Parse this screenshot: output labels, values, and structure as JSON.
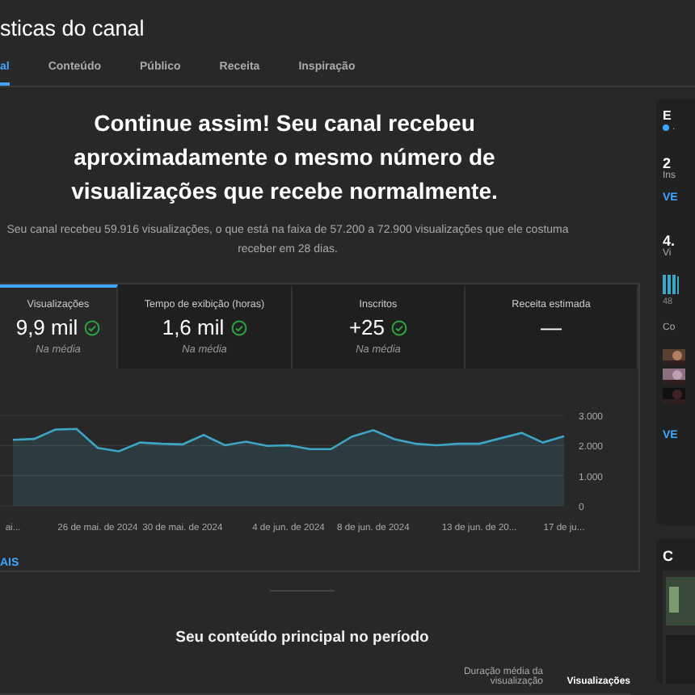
{
  "header": {
    "title": "sticas do canal"
  },
  "tabs": [
    {
      "label": "al",
      "selected": true
    },
    {
      "label": "Conteúdo",
      "selected": false
    },
    {
      "label": "Público",
      "selected": false
    },
    {
      "label": "Receita",
      "selected": false
    },
    {
      "label": "Inspiração",
      "selected": false
    }
  ],
  "summary": {
    "headline": "Continue assim! Seu canal recebeu aproximadamente o mesmo número de visualizações que recebe normalmente.",
    "detail": "Seu canal recebeu 59.916 visualizações, o que está na faixa de 57.200 a 72.900 visualizações que ele costuma receber em 28 dias."
  },
  "metrics": [
    {
      "label": "Visualizações",
      "value": "9,9 mil",
      "note": "Na média",
      "ok": true,
      "selected": true
    },
    {
      "label": "Tempo de exibição (horas)",
      "value": "1,6 mil",
      "note": "Na média",
      "ok": true,
      "selected": false
    },
    {
      "label": "Inscritos",
      "value": "+25",
      "note": "Na média",
      "ok": true,
      "selected": false
    },
    {
      "label": "Receita estimada",
      "value": "—",
      "ok": false,
      "selected": false
    }
  ],
  "chart": {
    "chart_data": {
      "type": "area",
      "categories": [
        "ai...",
        null,
        null,
        null,
        "26 de mai. de 2024",
        null,
        null,
        null,
        "30 de mai. de 2024",
        null,
        null,
        null,
        null,
        "4 de jun. de 2024",
        null,
        null,
        null,
        "8 de jun. de 2024",
        null,
        null,
        null,
        null,
        "13 de jun. de 20...",
        null,
        null,
        null,
        "17 de ju..."
      ],
      "series": [
        {
          "color": "#3ea6c4",
          "values": [
            2190,
            2220,
            2530,
            2550,
            1920,
            1810,
            2100,
            2060,
            2040,
            2350,
            2010,
            2130,
            1990,
            2010,
            1880,
            1880,
            2300,
            2510,
            2210,
            2060,
            2010,
            2060,
            2060,
            2240,
            2420,
            2100,
            2310
          ]
        }
      ],
      "ylim": [
        0,
        3000
      ],
      "yticks": [
        {
          "value": 0,
          "label": "0"
        },
        {
          "value": 1000,
          "label": "1.000"
        },
        {
          "value": 2000,
          "label": "2.000"
        },
        {
          "value": 3000,
          "label": "3.000"
        }
      ]
    },
    "more_link": "AIS"
  },
  "top_content": {
    "title": "Seu conteúdo principal no período",
    "columns": [
      "Duração média da visualização",
      "Visualizações"
    ]
  },
  "sidebar": {
    "card_1": {
      "title": "E",
      "status": ".",
      "stat_1": "2",
      "stat_1_label": "Ins",
      "link_1": "VE",
      "stat_2": "4.",
      "stat_2_label": "Vi",
      "bars_label": "48",
      "section": "Co",
      "link_2": "VE"
    },
    "card_2": {
      "title": "C"
    }
  }
}
